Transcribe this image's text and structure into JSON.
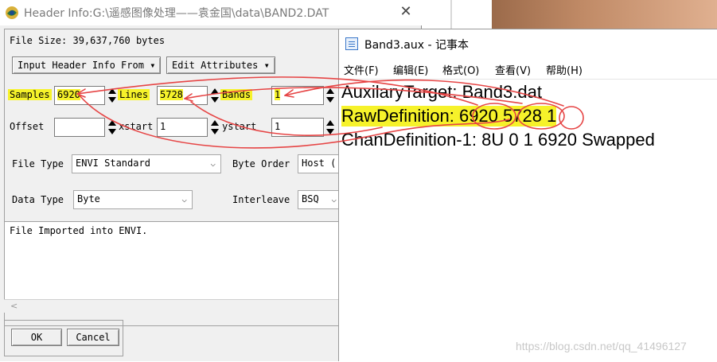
{
  "envi_dialog": {
    "title": "Header Info:G:\\遥感图像处理——袁金国\\data\\BAND2.DAT",
    "close_glyph": "✕",
    "file_size_text": "File Size: 39,637,760 bytes",
    "input_header_button": "Input Header Info From",
    "edit_attributes_button": "Edit Attributes",
    "samples_label": "Samples",
    "samples_value": "6920",
    "lines_label": "Lines",
    "lines_value": "5728",
    "bands_label": "Bands",
    "bands_value": "1",
    "offset_label": "Offset",
    "offset_value": "",
    "xstart_label": "xstart",
    "xstart_value": "1",
    "ystart_label": "ystart",
    "ystart_value": "1",
    "file_type_label": "File Type",
    "file_type_value": "ENVI Standard",
    "byte_order_label": "Byte Order",
    "byte_order_value": "Host (",
    "data_type_label": "Data Type",
    "data_type_value": "Byte",
    "interleave_label": "Interleave",
    "interleave_value": "BSQ",
    "description_text": "File Imported into ENVI.",
    "ok_button": "OK",
    "cancel_button": "Cancel"
  },
  "notepad": {
    "title": "Band3.aux - 记事本",
    "menu": [
      "文件(F)",
      "编辑(E)",
      "格式(O)",
      "查看(V)",
      "帮助(H)"
    ],
    "lines": [
      "AuxilaryTarget: Band3.dat",
      "RawDefinition: 6920 5728 1",
      "ChanDefinition-1: 8U 0 1 6920 Swapped"
    ]
  },
  "watermark": "https://blog.csdn.net/qq_41496127",
  "colors": {
    "highlight": "#f6f22a",
    "annotation_red": "#e64545"
  }
}
